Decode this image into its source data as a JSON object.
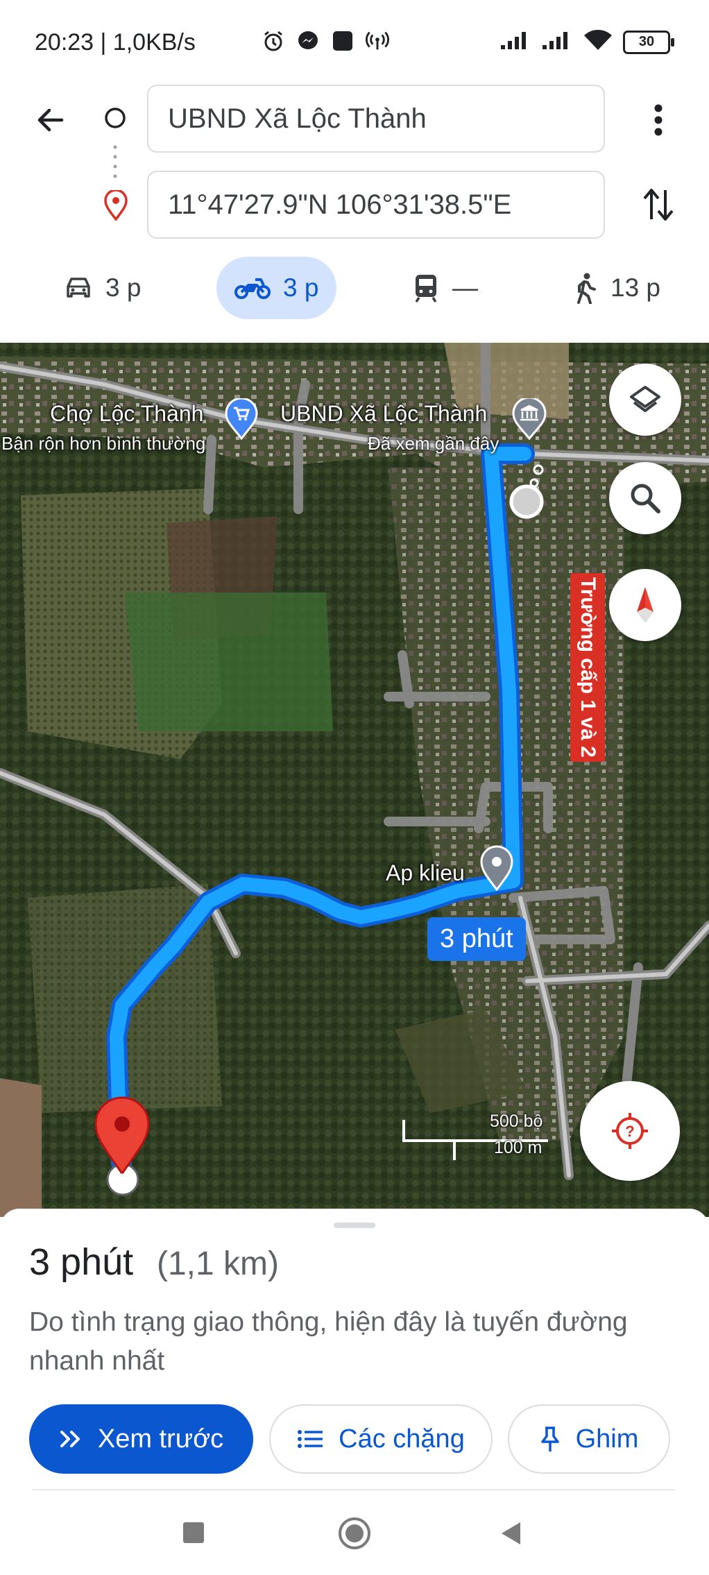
{
  "status_bar": {
    "text": "20:23 | 1,0KB/s",
    "battery": "30"
  },
  "directions": {
    "origin": "UBND Xã Lộc Thành",
    "destination": "11°47'27.9\"N 106°31'38.5\"E"
  },
  "modes": [
    {
      "icon": "car-icon",
      "label": "3 p"
    },
    {
      "icon": "motorbike-icon",
      "label": "3 p",
      "selected": true
    },
    {
      "icon": "transit-icon",
      "label": "—"
    },
    {
      "icon": "walk-icon",
      "label": "13 p"
    }
  ],
  "map": {
    "places": [
      {
        "name": "Chợ Lộc Thành",
        "sub": "Bận rộn hơn bình thường",
        "icon": "shopping-cart-icon"
      },
      {
        "name": "UBND Xã Lộc Thành",
        "sub": "Đã xem gần đây",
        "icon": "government-building-icon"
      },
      {
        "name": "Ap klieu",
        "icon": "place-pin-icon"
      }
    ],
    "school_label": "Trường cấp 1 và 2",
    "route_time": "3 phút",
    "scale_feet": "500 bộ",
    "scale_meters": "100 m"
  },
  "sheet": {
    "duration": "3 phút",
    "distance": "(1,1 km)",
    "description": "Do tình trạng giao thông, hiện đây là tuyến đường nhanh nhất",
    "preview_label": "Xem trước",
    "steps_label": "Các chặng",
    "pin_label": "Ghim"
  },
  "colors": {
    "accent": "#0b57d0",
    "route": "#1a9bfc",
    "destination_pin": "#d93025"
  }
}
